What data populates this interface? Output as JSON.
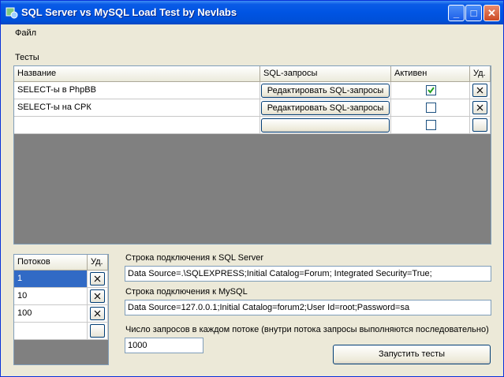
{
  "window": {
    "title": "SQL Server vs MySQL Load Test by Nevlabs",
    "icon": "app-icon",
    "controls": [
      "minimize-icon",
      "maximize-icon",
      "close-icon"
    ]
  },
  "menu": {
    "file": "Файл"
  },
  "tests": {
    "group_label": "Тесты",
    "columns": {
      "name": "Название",
      "sql": "SQL-запросы",
      "active": "Активен",
      "del": "Уд."
    },
    "rows": [
      {
        "name": "SELECT-ы в PhpBB",
        "sql_button": "Редактировать SQL-запросы",
        "active": true
      },
      {
        "name": "SELECT-ы на СРК",
        "sql_button": "Редактировать SQL-запросы",
        "active": false
      },
      {
        "name": "",
        "sql_button": "",
        "active": false
      }
    ]
  },
  "threads": {
    "columns": {
      "count": "Потоков",
      "del": "Уд."
    },
    "rows": [
      {
        "value": "1"
      },
      {
        "value": "10"
      },
      {
        "value": "100"
      },
      {
        "value": ""
      }
    ]
  },
  "sqlserver": {
    "label": "Строка подключения к SQL Server",
    "value": "Data Source=.\\SQLEXPRESS;Initial Catalog=Forum; Integrated Security=True;"
  },
  "mysql": {
    "label": "Строка подключения к MySQL",
    "value": "Data Source=127.0.0.1;Initial Catalog=forum2;User Id=root;Password=sa"
  },
  "requests": {
    "label": "Число запросов в каждом потоке (внутри потока запросы выполняются последовательно)",
    "value": "1000"
  },
  "run_button": "Запустить тесты",
  "colors": {
    "titlebar": "#0054e3",
    "selection": "#316ac5",
    "grid_bg": "#808080",
    "window_bg": "#ece9d8"
  }
}
